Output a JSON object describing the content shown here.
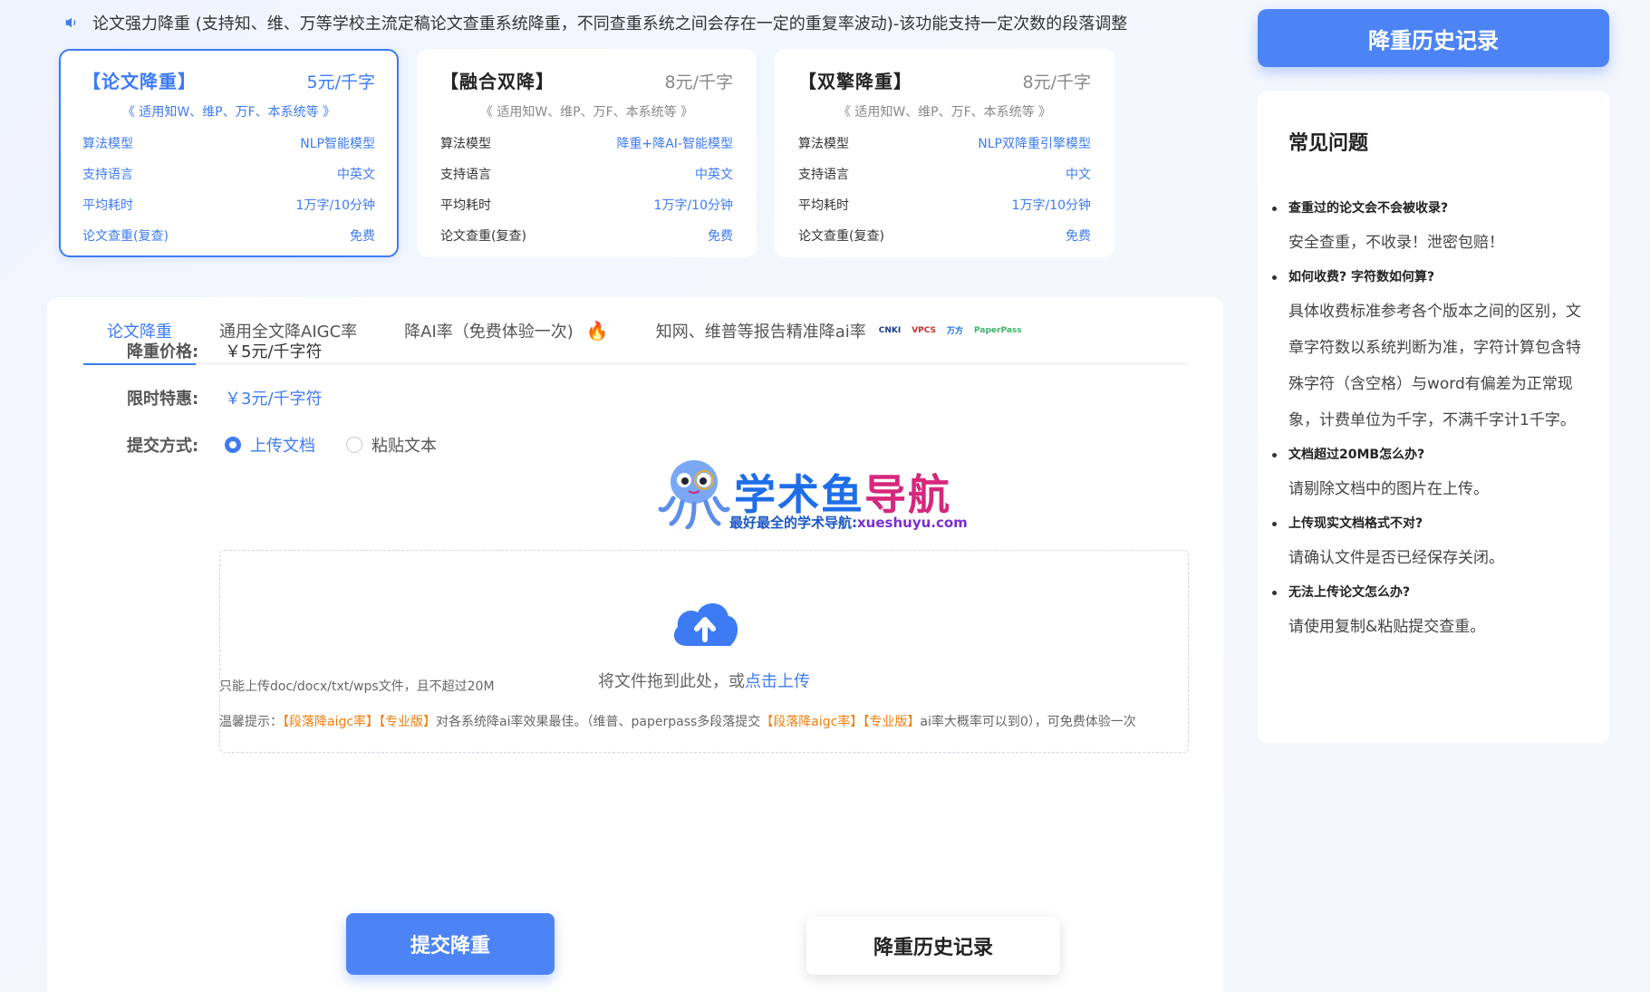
{
  "notice": {
    "icon": "speaker-icon",
    "text": "论文强力降重 (支持知、维、万等学校主流定稿论文查重系统降重，不同查重系统之间会存在一定的重复率波动)-该功能支持一定次数的段落调整"
  },
  "cards": [
    {
      "name": "【论文降重】",
      "price": "5元/千字",
      "scope": "《 适用知W、维P、万F、本系统等 》",
      "rows": [
        {
          "k": "算法模型",
          "v": "NLP智能模型"
        },
        {
          "k": "支持语言",
          "v": "中英文"
        },
        {
          "k": "平均耗时",
          "v": "1万字/10分钟"
        },
        {
          "k": "论文查重(复查)",
          "v": "免费"
        }
      ]
    },
    {
      "name": "【融合双降】",
      "price": "8元/千字",
      "scope": "《 适用知W、维P、万F、本系统等 》",
      "rows": [
        {
          "k": "算法模型",
          "v": "降重+降AI-智能模型"
        },
        {
          "k": "支持语言",
          "v": "中英文"
        },
        {
          "k": "平均耗时",
          "v": "1万字/10分钟"
        },
        {
          "k": "论文查重(复查)",
          "v": "免费"
        }
      ]
    },
    {
      "name": "【双擎降重】",
      "price": "8元/千字",
      "scope": "《 适用知W、维P、万F、本系统等 》",
      "rows": [
        {
          "k": "算法模型",
          "v": "NLP双降重引擎模型"
        },
        {
          "k": "支持语言",
          "v": "中文"
        },
        {
          "k": "平均耗时",
          "v": "1万字/10分钟"
        },
        {
          "k": "论文查重(复查)",
          "v": "免费"
        }
      ]
    }
  ],
  "tabs": {
    "t1": "论文降重",
    "t2": "通用全文降AIGC率",
    "t3": "降AI率（免费体验一次)",
    "t4": "知网、维普等报告精准降ai率",
    "logos": [
      "CNKI",
      "VPCS",
      "万方",
      "PaperPass"
    ]
  },
  "form": {
    "price_label": "降重价格:",
    "price_value": "￥5元/千字符",
    "special_label": "限时特惠:",
    "special_value": "￥3元/千字符",
    "submit_label": "提交方式:",
    "opt_upload": "上传文档",
    "opt_paste": "粘贴文本"
  },
  "dropzone": {
    "text": "将文件拖到此处，或",
    "link": "点击上传"
  },
  "hints": {
    "formats": "只能上传doc/docx/txt/wps文件，且不超过20M",
    "tip_prefix": "温馨提示：",
    "tip_tag1": "【段落降aigc率】",
    "tip_tag2": "【专业版】",
    "tip_mid": "对各系统降ai率效果最佳。（维普、paperpass多段落提交",
    "tip_tag3": "【段落降aigc率】",
    "tip_tag4": "【专业版】",
    "tip_end": "ai率大概率可以到0），可免费体验一次"
  },
  "buttons": {
    "submit": "提交降重",
    "history": "降重历史记录"
  },
  "watermark": {
    "title_a": "学术鱼",
    "title_b": "导航",
    "sub_a": "最好最全的学术导航:",
    "sub_b": "xueshuyu.com"
  },
  "sidebar": {
    "history_button": "降重历史记录",
    "faq_title": "常见问题",
    "faqs": [
      {
        "q": "查重过的论文会不会被收录?",
        "a": "安全查重，不收录！泄密包赔！"
      },
      {
        "q": "如何收费? 字符数如何算?",
        "a": "具体收费标准参考各个版本之间的区别，文章字符数以系统判断为准，字符计算包含特殊字符（含空格）与word有偏差为正常现象，计费单位为千字，不满千字计1千字。"
      },
      {
        "q": "文档超过20MB怎么办?",
        "a": "请剔除文档中的图片在上传。"
      },
      {
        "q": "上传现实文档格式不对?",
        "a": "请确认文件是否已经保存关闭。"
      },
      {
        "q": "无法上传论文怎么办?",
        "a": "请使用复制&粘贴提交查重。"
      }
    ]
  },
  "colors": {
    "accent": "#3d7bf5",
    "orange": "#f07d0c",
    "fire": "#f0441c"
  }
}
